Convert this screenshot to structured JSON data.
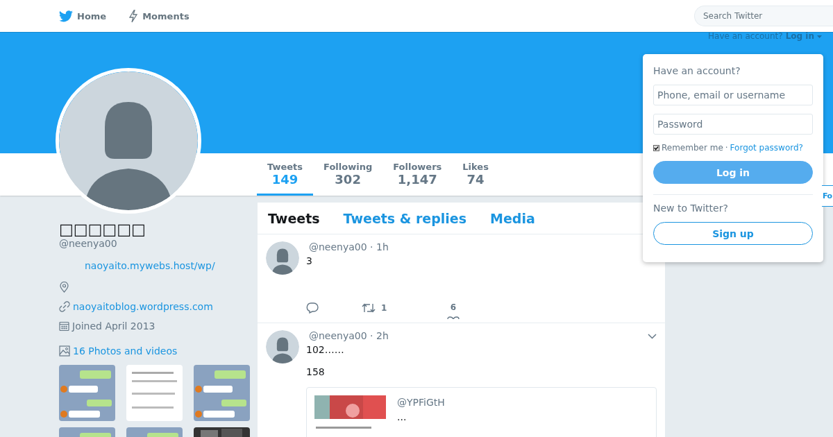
{
  "nav": {
    "items": [
      {
        "label": "Home"
      },
      {
        "label": "Moments"
      }
    ],
    "search": {
      "placeholder": "Search Twitter"
    }
  },
  "banner_login": {
    "prompt": "Have an account?",
    "link": "Log in"
  },
  "stats": [
    {
      "label": "Tweets",
      "value": "149",
      "selected": true
    },
    {
      "label": "Following",
      "value": "302",
      "selected": false
    },
    {
      "label": "Followers",
      "value": "1,147",
      "selected": false
    },
    {
      "label": "Likes",
      "value": "74",
      "selected": false
    }
  ],
  "follow_button": {
    "label": "Fo"
  },
  "profile": {
    "name": "□□□□□□",
    "handle": "@neenya00",
    "bio_link": "naoyaito.mywebs.host/wp/",
    "website": "naoyaitoblog.wordpress.com",
    "joined": "Joined April 2013",
    "photos_link": "16 Photos and videos"
  },
  "timeline": {
    "tabs": [
      {
        "label": "Tweets",
        "selected": true
      },
      {
        "label": "Tweets & replies",
        "selected": false
      },
      {
        "label": "Media",
        "selected": false
      }
    ],
    "tweets": [
      {
        "meta": "@neenya00 · 1h",
        "text": [
          "3"
        ],
        "actions": {
          "retweets": "1",
          "likes": "6"
        }
      },
      {
        "meta": "@neenya00 · 2h",
        "text": [
          "102……",
          "158"
        ],
        "menu": true,
        "quote": {
          "handle": "@YPFiGtH",
          "text": "..."
        }
      }
    ]
  },
  "login_popup": {
    "title": "Have an account?",
    "username": {
      "placeholder": "Phone, email or username"
    },
    "password": {
      "placeholder": "Password"
    },
    "remember_me": {
      "label": "Remember me",
      "checked": true
    },
    "separator": "·",
    "forgot": "Forgot password?",
    "login_button": "Log in",
    "signup_prompt": "New to Twitter?",
    "signup_button": "Sign up"
  }
}
